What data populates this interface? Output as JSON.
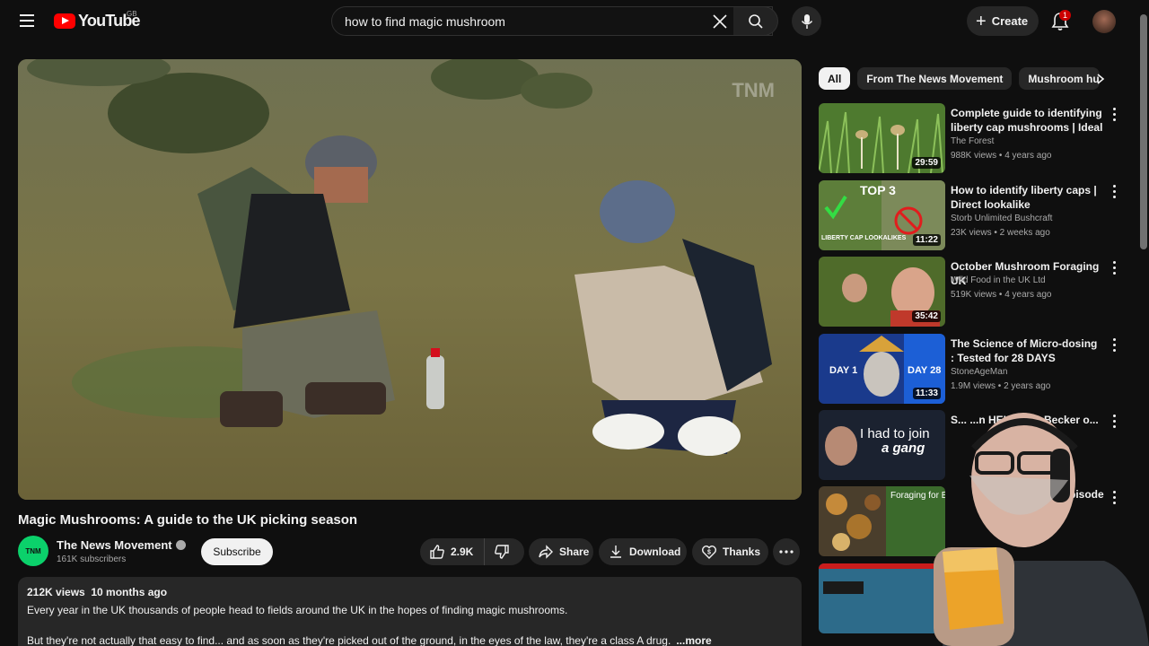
{
  "header": {
    "logo_text": "YouTube",
    "country_code": "GB",
    "search_value": "how to find magic mushroom",
    "create_label": "Create",
    "notification_count": "1"
  },
  "player": {
    "watermark": "TNM"
  },
  "video": {
    "title": "Magic Mushrooms: A guide to the UK picking season",
    "channel_name": "The News Movement",
    "channel_avatar_text": "TNM",
    "subscribers": "161K subscribers",
    "subscribe_label": "Subscribe",
    "likes": "2.9K",
    "share_label": "Share",
    "download_label": "Download",
    "thanks_label": "Thanks"
  },
  "description": {
    "meta": "212K views  10 months ago",
    "line1": "Every year in the UK thousands of people head to fields around the UK in the hopes of finding magic mushrooms.",
    "line2": "But they're not actually that easy to find... and as soon as they're picked out of the ground, in the eyes of the law, they're a class A drug.",
    "more": "...more"
  },
  "chips": [
    "All",
    "From The News Movement",
    "Mushroom hu"
  ],
  "recommendations": [
    {
      "title": "Complete guide to identifying liberty cap mushrooms | Ideal ...",
      "channel": "The Forest",
      "meta": "988K views • 4 years ago",
      "duration": "29:59",
      "thumb_text": ""
    },
    {
      "title": "How to identify liberty caps | Direct lookalike COMPARISON...",
      "channel": "Storb Unlimited Bushcraft",
      "meta": "23K views • 2 weeks ago",
      "duration": "11:22",
      "thumb_text": "TOP 3",
      "thumb_text2": "LIBERTY CAP LOOKALIKES"
    },
    {
      "title": "October Mushroom Foraging UK",
      "channel": "Wild Food in the UK Ltd",
      "meta": "519K views • 4 years ago",
      "duration": "35:42",
      "thumb_text": ""
    },
    {
      "title": "The Science of Micro-dosing : Tested for 28 DAYS",
      "channel": "StoneAgeMan",
      "meta": "1.9M views • 2 years ago",
      "duration": "11:33",
      "thumb_text": "DAY 1",
      "thumb_text2": "DAY 28"
    },
    {
      "title": "S... ...n HELL: ...is Becker o...",
      "channel": "",
      "meta": "",
      "duration": "",
      "thumb_text": "I had to join",
      "thumb_text2": "a gang"
    },
    {
      "title": "Episode",
      "channel": "",
      "meta": "",
      "duration": "",
      "thumb_text": "Foraging for Beginn..."
    },
    {
      "title": "",
      "channel": "",
      "meta": "",
      "duration": "",
      "thumb_text": ""
    }
  ],
  "colors": {
    "background": "#0f0f0f",
    "accent": "#ff0000",
    "chip_active": "#f1f1f1",
    "pill": "#272727"
  }
}
